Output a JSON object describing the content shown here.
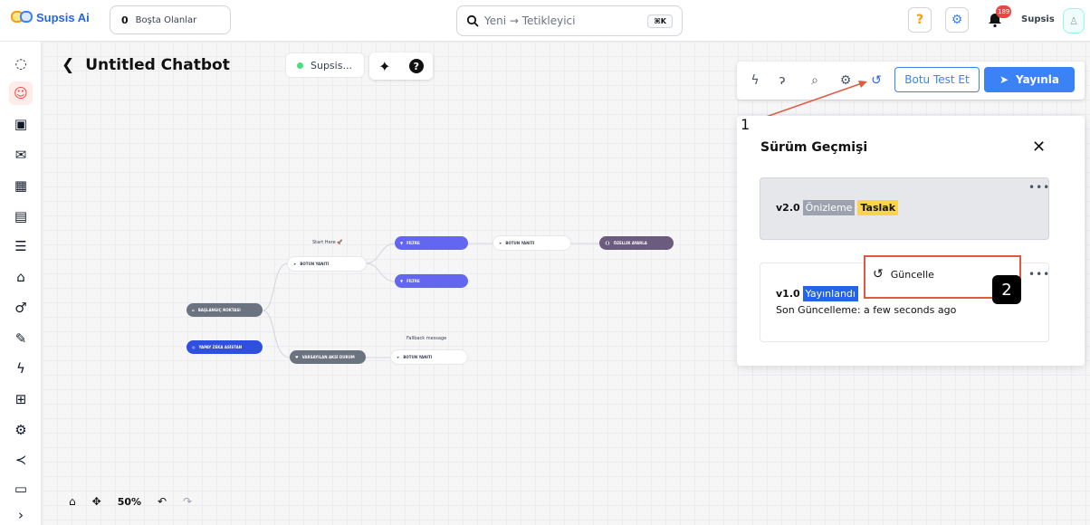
{
  "topbar": {
    "logo_text": "Supsis Ai",
    "idle_count": "0",
    "idle_label": "Boşta Olanlar",
    "search_placeholder": "Yeni → Tetikleyici",
    "search_shortcut": "⌘K",
    "notification_count": "189",
    "username": "Supsis"
  },
  "canvas": {
    "title": "Untitled Chatbot",
    "agent_chip": "Supsis...",
    "zoom": "50%"
  },
  "flow": {
    "start_caption": "Start Here 🚀",
    "fallback_caption": "Fallback message",
    "nodes": {
      "start": "BAŞLANGIÇ NOKTASI",
      "ai": "YAPAY ZEKA ASİSTAN",
      "default": "VARSAYILAN AKSİ DURUM",
      "reply1": "BOTUN YANITI",
      "filter1": "FİLTRE",
      "filter2": "FİLTRE",
      "reply2": "BOTUN YANITI",
      "custom": "ÖZELLİK AYARLA",
      "reply3": "BOTUN YANITI"
    }
  },
  "toolbar": {
    "test_label": "Botu Test Et",
    "publish_label": "Yayınla"
  },
  "version_panel": {
    "title": "Sürüm Geçmişi",
    "versions": [
      {
        "version": "v2.0",
        "tags": [
          "Önizleme",
          "Taslak"
        ]
      },
      {
        "version": "v1.0",
        "tags": [
          "Yayınlandı"
        ],
        "updated": "Son Güncelleme: a few seconds ago"
      }
    ],
    "menu_update": "Güncelle"
  },
  "annotations": {
    "step1": "1",
    "step2": "2"
  },
  "colors": {
    "accent": "#3b82f6",
    "highlight": "#e05a41",
    "filter": "#6366f1"
  }
}
